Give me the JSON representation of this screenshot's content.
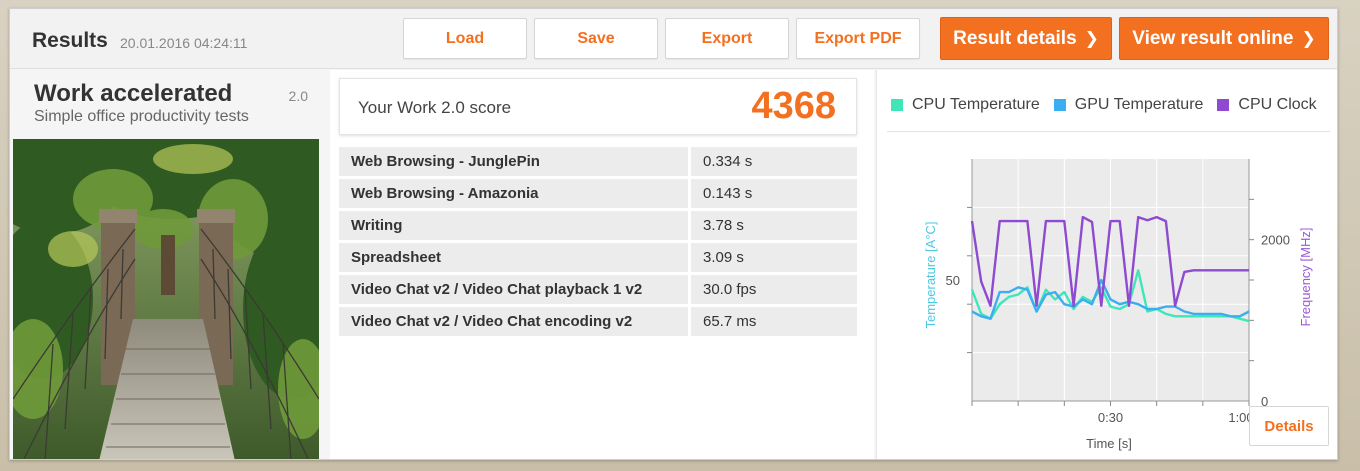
{
  "header": {
    "title": "Results",
    "date": "20.01.2016 04:24:11",
    "buttons": {
      "load": "Load",
      "save": "Save",
      "export": "Export",
      "export_pdf": "Export PDF"
    },
    "result_details": "Result details",
    "view_online": "View result online",
    "chevron": "❯"
  },
  "test": {
    "title": "Work accelerated",
    "subtitle": "Simple office productivity tests",
    "version": "2.0",
    "image_icon": "rope-bridge-photo"
  },
  "score": {
    "label": "Your Work 2.0 score",
    "value": "4368"
  },
  "results": [
    {
      "name": "Web Browsing - JunglePin",
      "value": "0.334 s"
    },
    {
      "name": "Web Browsing - Amazonia",
      "value": "0.143 s"
    },
    {
      "name": "Writing",
      "value": "3.78 s"
    },
    {
      "name": "Spreadsheet",
      "value": "3.09 s"
    },
    {
      "name": "Video Chat v2 / Video Chat playback 1 v2",
      "value": "30.0 fps"
    },
    {
      "name": "Video Chat v2 / Video Chat encoding v2",
      "value": "65.7 ms"
    }
  ],
  "colors": {
    "accent": "#f37021",
    "cpu_temp": "#3ee6b8",
    "gpu_temp": "#3aaef0",
    "cpu_clock": "#8e4ad0"
  },
  "details_button": "Details",
  "chart_data": {
    "type": "line",
    "legend": [
      "CPU Temperature",
      "GPU Temperature",
      "CPU Clock"
    ],
    "legend_position": "top",
    "xlabel": "Time [s]",
    "ylabel_left": "Temperature [A°C]",
    "ylabel_right": "Frequency [MHz]",
    "x_ticks": [
      "0:30",
      "1:00"
    ],
    "y_left_ticks": [
      "50"
    ],
    "y_right_ticks": [
      "2000",
      "0"
    ],
    "xlim": [
      0,
      60
    ],
    "ylim_left": [
      0,
      100
    ],
    "ylim_right": [
      0,
      3000
    ],
    "grid": true,
    "series": [
      {
        "name": "CPU Temperature",
        "axis": "left",
        "x": [
          0,
          2,
          4,
          6,
          8,
          10,
          12,
          14,
          16,
          18,
          20,
          22,
          24,
          26,
          28,
          30,
          32,
          34,
          36,
          38,
          40,
          42,
          44,
          46,
          48,
          50,
          52,
          54,
          56,
          58,
          60
        ],
        "y": [
          46,
          36,
          34,
          40,
          43,
          44,
          47,
          37,
          46,
          42,
          45,
          38,
          43,
          41,
          47,
          39,
          38,
          40,
          54,
          37,
          38,
          36,
          35,
          35,
          35,
          35,
          35,
          35,
          35,
          34,
          33
        ]
      },
      {
        "name": "GPU Temperature",
        "axis": "left",
        "x": [
          0,
          2,
          4,
          6,
          8,
          10,
          12,
          14,
          16,
          18,
          20,
          22,
          24,
          26,
          28,
          30,
          32,
          34,
          36,
          38,
          40,
          42,
          44,
          46,
          48,
          50,
          52,
          54,
          56,
          58,
          60
        ],
        "y": [
          37,
          35,
          34,
          45,
          45,
          47,
          46,
          37,
          44,
          45,
          40,
          39,
          42,
          40,
          50,
          42,
          40,
          41,
          40,
          38,
          38,
          39,
          39,
          37,
          36,
          36,
          36,
          36,
          35,
          35,
          37
        ]
      },
      {
        "name": "CPU Clock",
        "axis": "right",
        "x": [
          0,
          2,
          4,
          6,
          8,
          10,
          12,
          14,
          16,
          18,
          20,
          22,
          24,
          26,
          28,
          30,
          32,
          34,
          36,
          38,
          40,
          42,
          44,
          46,
          48,
          50,
          52,
          54,
          56,
          58,
          60
        ],
        "y": [
          2230,
          1480,
          1180,
          2230,
          2230,
          2230,
          2230,
          1180,
          2230,
          2230,
          2230,
          1180,
          2280,
          2220,
          1180,
          2230,
          2230,
          1180,
          2280,
          2240,
          2280,
          2230,
          1180,
          1600,
          1620,
          1620,
          1620,
          1620,
          1620,
          1620,
          1620
        ]
      }
    ]
  }
}
